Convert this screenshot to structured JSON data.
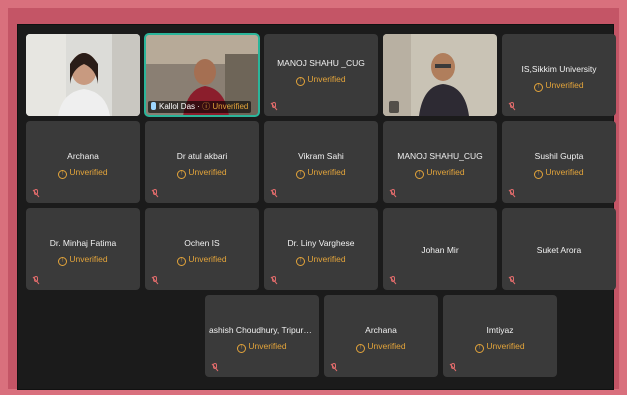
{
  "participants": [
    {
      "name": "",
      "status": "",
      "video": true
    },
    {
      "name": "Kallol Das",
      "status": "Unverified",
      "video": true
    },
    {
      "name": "MANOJ SHAHU _CUG",
      "status": "Unverified",
      "video": false
    },
    {
      "name": "",
      "status": "",
      "video": true
    },
    {
      "name": "IS,Sikkim University",
      "status": "Unverified",
      "video": false
    },
    {
      "name": "Archana",
      "status": "Unverified",
      "video": false
    },
    {
      "name": "Dr atul akbari",
      "status": "Unverified",
      "video": false
    },
    {
      "name": "Vikram Sahi",
      "status": "Unverified",
      "video": false
    },
    {
      "name": "MANOJ SHAHU_CUG",
      "status": "Unverified",
      "video": false
    },
    {
      "name": "Sushil Gupta",
      "status": "Unverified",
      "video": false
    },
    {
      "name": "Dr. Minhaj Fatima",
      "status": "Unverified",
      "video": false
    },
    {
      "name": "Ochen IS",
      "status": "Unverified",
      "video": false
    },
    {
      "name": "Dr. Liny Varghese",
      "status": "Unverified",
      "video": false
    },
    {
      "name": "Johan Mir",
      "status": "",
      "video": false
    },
    {
      "name": "Suket Arora",
      "status": "",
      "video": false
    },
    {
      "name": "ashish Choudhury, Tripura ...",
      "status": "Unverified",
      "video": false
    },
    {
      "name": "Archana",
      "status": "Unverified",
      "video": false
    },
    {
      "name": "Imtiyaz",
      "status": "Unverified",
      "video": false
    }
  ],
  "icons": {
    "muted": "mic-off-icon",
    "unverified": "warning-circle-icon"
  },
  "colors": {
    "unverified": "#e3a43a",
    "active_speaker": "#2bb59a",
    "tile": "#3a3a3a",
    "frame": "#c45566"
  }
}
